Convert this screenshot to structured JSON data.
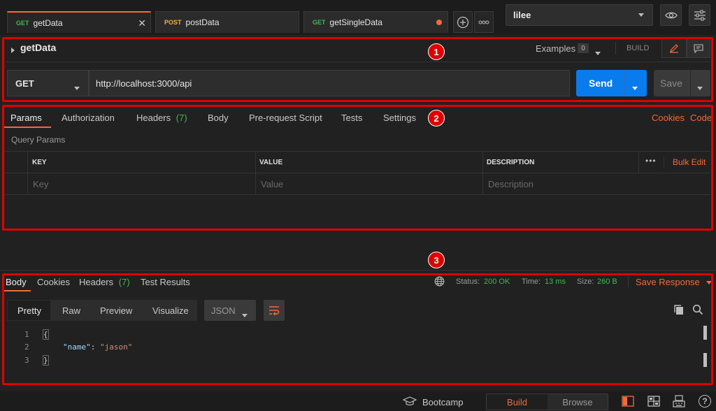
{
  "tabs": [
    {
      "method": "GET",
      "name": "getData"
    },
    {
      "method": "POST",
      "name": "postData"
    },
    {
      "method": "GET",
      "name": "getSingleData"
    }
  ],
  "environment": "lilee",
  "request": {
    "title": "getData",
    "examples_label": "Examples",
    "examples_count": "0",
    "build_label": "BUILD",
    "method": "GET",
    "url": "http://localhost:3000/api",
    "send_label": "Send",
    "save_label": "Save"
  },
  "req_tabs": {
    "params": "Params",
    "authorization": "Authorization",
    "headers": "Headers",
    "headers_count": "(7)",
    "body": "Body",
    "prerequest": "Pre-request Script",
    "tests": "Tests",
    "settings": "Settings",
    "cookies": "Cookies",
    "code": "Code"
  },
  "query_params": {
    "title": "Query Params",
    "columns": [
      "KEY",
      "VALUE",
      "DESCRIPTION"
    ],
    "more": "•••",
    "bulk_edit": "Bulk Edit",
    "placeholders": [
      "Key",
      "Value",
      "Description"
    ]
  },
  "response": {
    "tabs": {
      "body": "Body",
      "cookies": "Cookies",
      "headers": "Headers",
      "headers_count": "(7)",
      "test_results": "Test Results"
    },
    "status_label": "Status:",
    "status_value": "200 OK",
    "time_label": "Time:",
    "time_value": "13 ms",
    "size_label": "Size:",
    "size_value": "260 B",
    "save_response": "Save Response",
    "views": [
      "Pretty",
      "Raw",
      "Preview",
      "Visualize"
    ],
    "format": "JSON",
    "lines": [
      {
        "n": "1",
        "text": "{"
      },
      {
        "n": "2",
        "key": "\"name\"",
        "colon": ": ",
        "value": "\"jason\""
      },
      {
        "n": "3",
        "text": "}"
      }
    ]
  },
  "annotations": [
    "1",
    "2",
    "3"
  ],
  "footer": {
    "bootcamp": "Bootcamp",
    "build": "Build",
    "browse": "Browse",
    "help": "?"
  },
  "colors": {
    "accent": "#f26b3a",
    "send": "#097bed",
    "success": "#3fb950",
    "highlight": "#e00000"
  }
}
